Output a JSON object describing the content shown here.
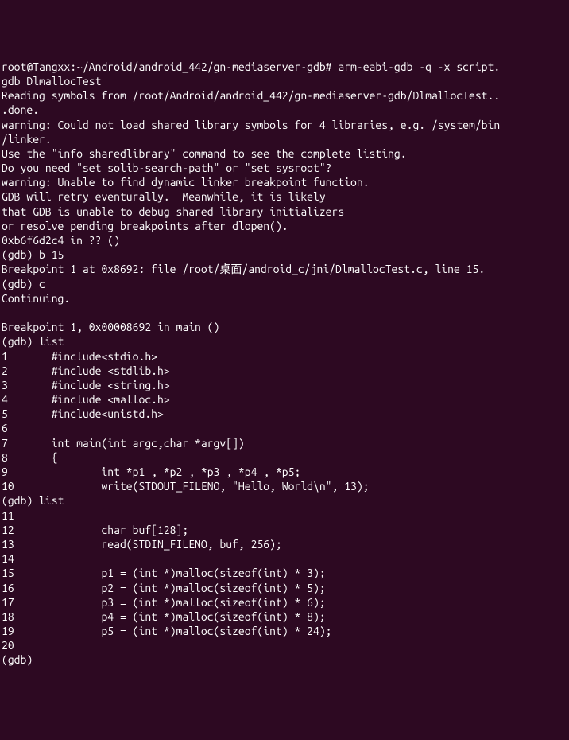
{
  "terminal": {
    "lines": [
      "root@Tangxx:~/Android/android_442/gn-mediaserver-gdb# arm-eabi-gdb -q -x script.",
      "gdb DlmallocTest",
      "Reading symbols from /root/Android/android_442/gn-mediaserver-gdb/DlmallocTest..",
      ".done.",
      "warning: Could not load shared library symbols for 4 libraries, e.g. /system/bin",
      "/linker.",
      "Use the \"info sharedlibrary\" command to see the complete listing.",
      "Do you need \"set solib-search-path\" or \"set sysroot\"?",
      "warning: Unable to find dynamic linker breakpoint function.",
      "GDB will retry eventurally.  Meanwhile, it is likely",
      "that GDB is unable to debug shared library initializers",
      "or resolve pending breakpoints after dlopen().",
      "0xb6f6d2c4 in ?? ()",
      "(gdb) b 15",
      "Breakpoint 1 at 0x8692: file /root/桌面/android_c/jni/DlmallocTest.c, line 15.",
      "(gdb) c",
      "Continuing.",
      "",
      "Breakpoint 1, 0x00008692 in main ()",
      "(gdb) list",
      "1       #include<stdio.h>",
      "2       #include <stdlib.h>",
      "3       #include <string.h>",
      "4       #include <malloc.h>",
      "5       #include<unistd.h>",
      "6",
      "7       int main(int argc,char *argv[])",
      "8       {",
      "9               int *p1 , *p2 , *p3 , *p4 , *p5;",
      "10              write(STDOUT_FILENO, \"Hello, World\\n\", 13);",
      "(gdb) list",
      "11",
      "12              char buf[128];",
      "13              read(STDIN_FILENO, buf, 256);",
      "14",
      "15              p1 = (int *)malloc(sizeof(int) * 3);",
      "16              p2 = (int *)malloc(sizeof(int) * 5);",
      "17              p3 = (int *)malloc(sizeof(int) * 6);",
      "18              p4 = (int *)malloc(sizeof(int) * 8);",
      "19              p5 = (int *)malloc(sizeof(int) * 24);",
      "20",
      "(gdb) "
    ]
  }
}
